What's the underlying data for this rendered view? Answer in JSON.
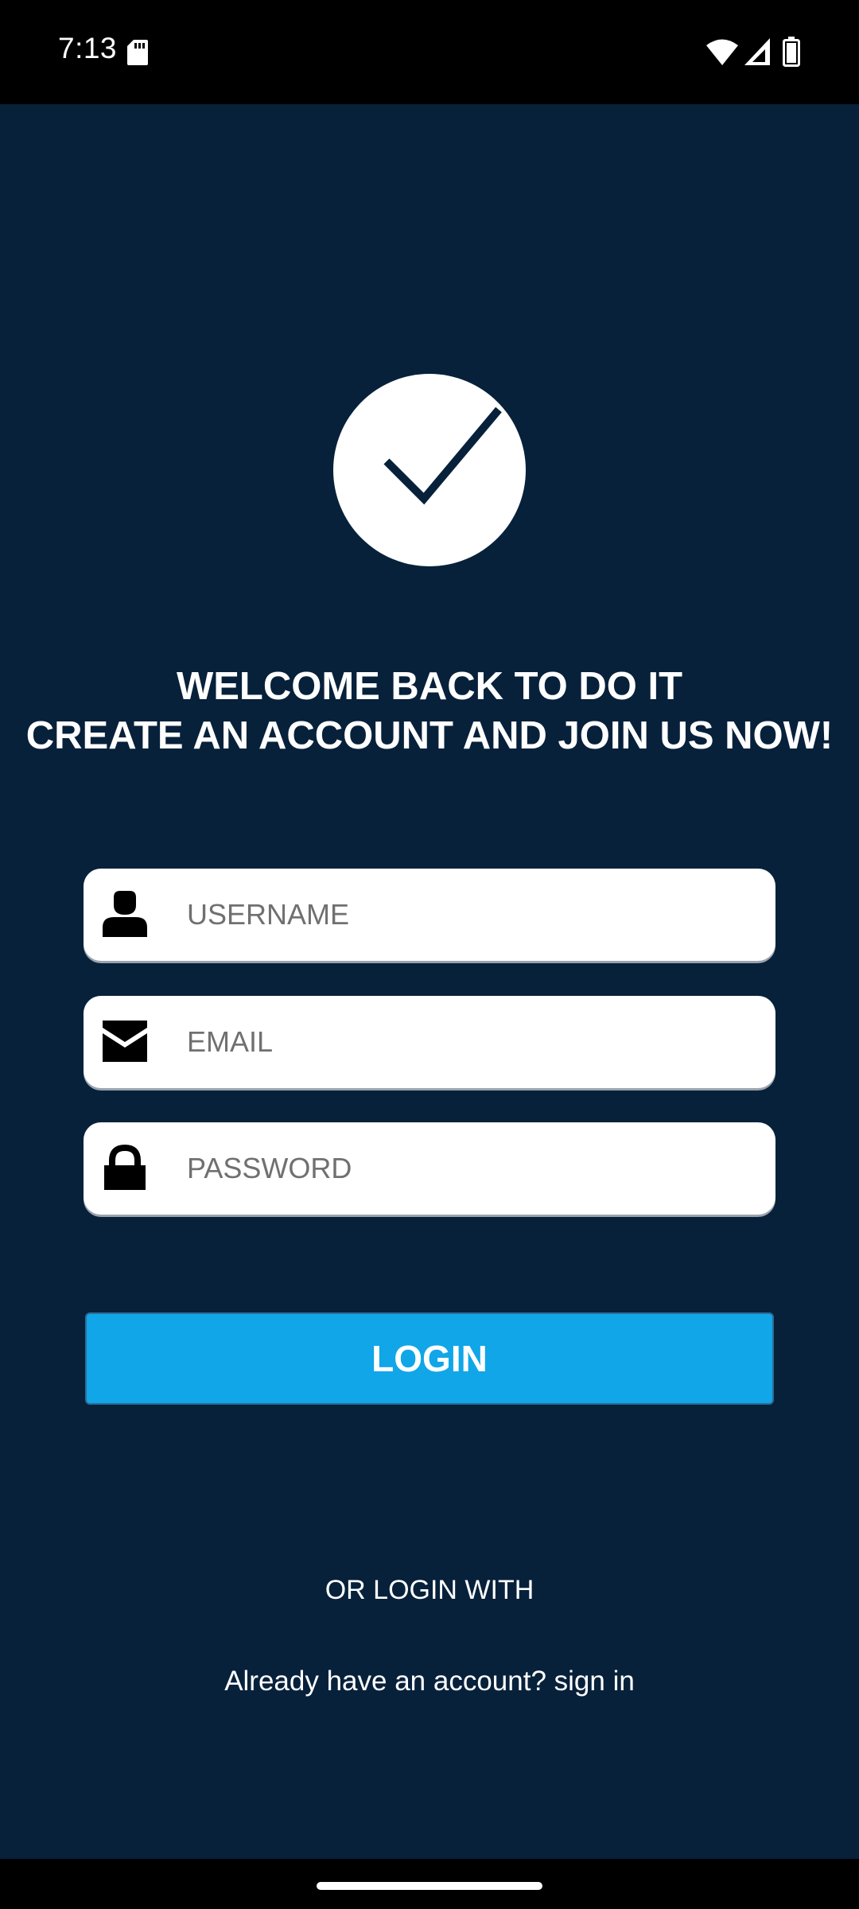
{
  "status_bar": {
    "time": "7:13",
    "icons": [
      "sd-card-icon",
      "wifi-icon",
      "signal-icon",
      "battery-icon"
    ]
  },
  "logo": {
    "icon": "checkmark-icon",
    "bg_color": "#ffffff",
    "check_color": "#07213b"
  },
  "welcome": {
    "line1": "WELCOME BACK TO DO IT",
    "line2": "CREATE AN ACCOUNT AND JOIN US NOW!"
  },
  "form": {
    "username": {
      "placeholder": "USERNAME",
      "value": "",
      "icon": "person-icon"
    },
    "email": {
      "placeholder": "EMAIL",
      "value": "",
      "icon": "envelope-icon"
    },
    "password": {
      "placeholder": "PASSWORD",
      "value": "",
      "icon": "lock-icon"
    }
  },
  "login_button": {
    "label": "LOGIN"
  },
  "or_login_with": "OR LOGIN WITH",
  "already_account": "Already have an account? sign in",
  "colors": {
    "background": "#07213b",
    "accent": "#10a6e8",
    "text": "#ffffff"
  }
}
